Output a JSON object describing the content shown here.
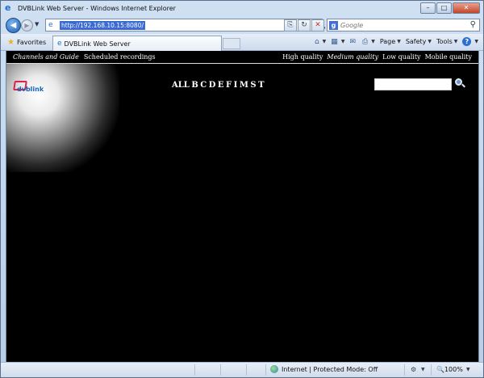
{
  "window": {
    "title": "DVBLink Web Server - Windows Internet Explorer",
    "minimize": "–",
    "maximize": "□",
    "close": "✕"
  },
  "address": {
    "url": "http://192.168.10.15:8080/",
    "search_placeholder": "Google"
  },
  "favorites_bar": {
    "favorites_label": "Favorites",
    "tab_label": "DVBLink Web Server"
  },
  "command_bar": {
    "page_label": "Page",
    "safety_label": "Safety",
    "tools_label": "Tools"
  },
  "site": {
    "menu_left": [
      "Channels and Guide",
      "Scheduled recordings"
    ],
    "menu_right": [
      "High quality",
      "Medium quality",
      "Low quality",
      "Mobile quality"
    ],
    "letters": [
      "ALL",
      "B",
      "C",
      "D",
      "E",
      "F",
      "I",
      "M",
      "S",
      "T"
    ],
    "logo_text": "dvblink"
  },
  "status_bar": {
    "zone_text": "Internet | Protected Mode: Off",
    "zoom": "100%"
  },
  "colors": {
    "content_background": "#000000",
    "logo_red": "#d9234a",
    "logo_blue": "#1b66b8"
  },
  "icons": {
    "browser": "ie-icon",
    "search": "magnifier-icon",
    "favorites": "star-icon",
    "zone": "globe-icon"
  }
}
